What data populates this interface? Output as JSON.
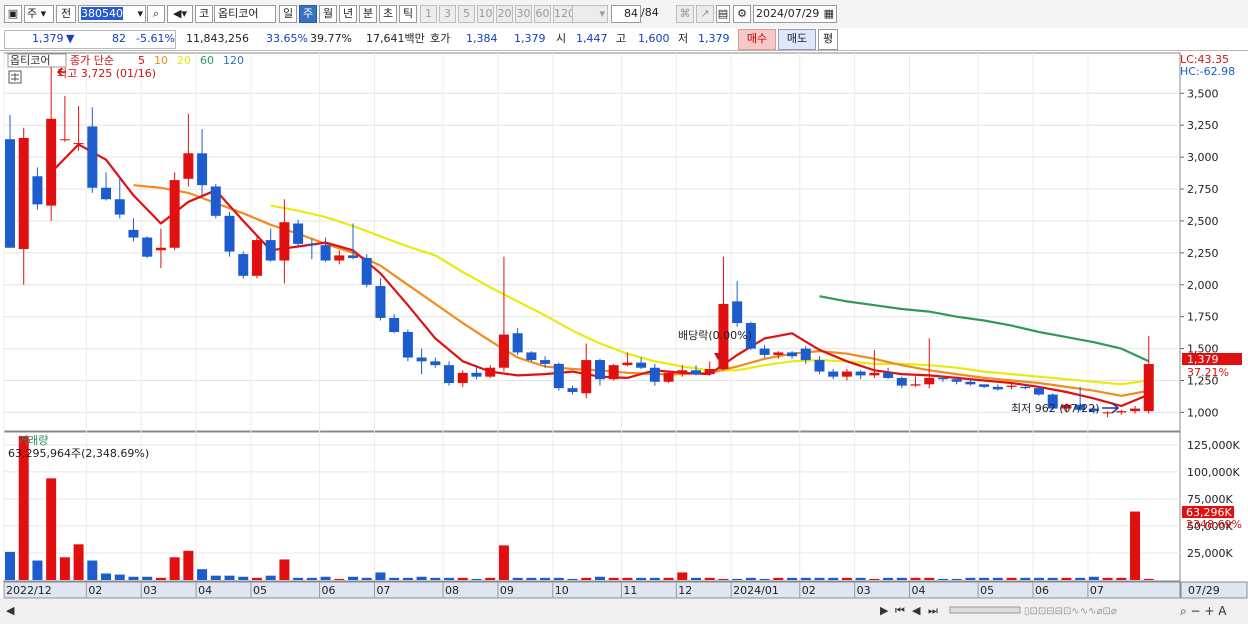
{
  "toolbar": {
    "period_type": "주",
    "view_mode": "전",
    "stock_code": "380540",
    "market_tag": "코",
    "stock_name": "옵티코어",
    "period_tabs": [
      "일",
      "주",
      "월",
      "년",
      "분",
      "초",
      "틱"
    ],
    "period_selected": "주",
    "interval_tabs": [
      "1",
      "3",
      "5",
      "10",
      "20",
      "30",
      "60",
      "120"
    ],
    "count": "84",
    "count_total": "/84",
    "date": "2024/07/29"
  },
  "quote": {
    "price": "1,379",
    "change_dir": "▼",
    "change": "82",
    "change_pct": "-5.61%",
    "volume": "11,843,256",
    "vol_ratio1": "33.65%",
    "vol_ratio2": "39.77%",
    "amount": "17,641백만",
    "ask_label": "호가",
    "ask1": "1,384",
    "ask2": "1,379",
    "open_label": "시",
    "open": "1,447",
    "high_label": "고",
    "high": "1,600",
    "low_label": "저",
    "low": "1,379",
    "buy": "매수",
    "sell": "매도",
    "avg": "평"
  },
  "price_panel": {
    "name": "옵티코어",
    "ma_label": "종가 단순",
    "ma_periods": [
      "5",
      "10",
      "20",
      "60",
      "120"
    ],
    "ma_colors": [
      "#e01010",
      "#f08c1c",
      "#eaea10",
      "#2e9a5a",
      "#2a70c0"
    ],
    "max_label": "최고 3,725 (01/16)",
    "min_label": "최저 962 (07/22)",
    "event_label": "배당락(0.00%)",
    "lc": "LC:43.35",
    "hc": "HC:-62.98",
    "current_tag": "1,379",
    "current_pct": "37.21%",
    "y_ticks": [
      "3,500",
      "3,250",
      "3,000",
      "2,750",
      "2,500",
      "2,250",
      "2,000",
      "1,750",
      "1,500",
      "1,250",
      "1,000"
    ]
  },
  "volume_panel": {
    "title": "거래량",
    "value_label": "63,295,964주(2,348.69%)",
    "current_tag": "63,296K",
    "current_pct": "2348.69%",
    "y_ticks": [
      "125,000K",
      "100,000K",
      "75,000K",
      "50,000K",
      "25,000K"
    ]
  },
  "x_axis": [
    "2022/12",
    "02",
    "03",
    "04",
    "05",
    "06",
    "07",
    "08",
    "09",
    "10",
    "11",
    "12",
    "2024/01",
    "02",
    "03",
    "04",
    "05",
    "06",
    "07"
  ],
  "x_axis_right": "07/29",
  "colors": {
    "up": "#e01010",
    "down": "#1c5ccc",
    "ma5": "#e01010",
    "ma10": "#f08c1c",
    "ma20": "#eaea10",
    "ma60": "#2e9a5a"
  },
  "chart_data": {
    "type": "candlestick",
    "period": "weekly",
    "ylim": [
      870,
      3800
    ],
    "x_labels": [
      "2022/12",
      "02",
      "03",
      "04",
      "05",
      "06",
      "07",
      "08",
      "09",
      "10",
      "11",
      "12",
      "2024/01",
      "02",
      "03",
      "04",
      "05",
      "06",
      "07"
    ],
    "candles": [
      {
        "o": 3140,
        "h": 3330,
        "l": 2290,
        "c": 2290
      },
      {
        "o": 2280,
        "h": 3230,
        "l": 2000,
        "c": 3150
      },
      {
        "o": 2850,
        "h": 2920,
        "l": 2590,
        "c": 2630
      },
      {
        "o": 2620,
        "h": 3725,
        "l": 2500,
        "c": 3300
      },
      {
        "o": 3140,
        "h": 3480,
        "l": 3120,
        "c": 3140
      },
      {
        "o": 3110,
        "h": 3400,
        "l": 3050,
        "c": 3110
      },
      {
        "o": 3240,
        "h": 3390,
        "l": 2720,
        "c": 2760
      },
      {
        "o": 2760,
        "h": 2880,
        "l": 2660,
        "c": 2670
      },
      {
        "o": 2670,
        "h": 2840,
        "l": 2520,
        "c": 2550
      },
      {
        "o": 2430,
        "h": 2520,
        "l": 2340,
        "c": 2370
      },
      {
        "o": 2370,
        "h": 2380,
        "l": 2210,
        "c": 2220
      },
      {
        "o": 2270,
        "h": 2440,
        "l": 2130,
        "c": 2290
      },
      {
        "o": 2290,
        "h": 2880,
        "l": 2270,
        "c": 2820
      },
      {
        "o": 2830,
        "h": 3340,
        "l": 2770,
        "c": 3030
      },
      {
        "o": 3030,
        "h": 3220,
        "l": 2700,
        "c": 2780
      },
      {
        "o": 2770,
        "h": 2790,
        "l": 2520,
        "c": 2540
      },
      {
        "o": 2540,
        "h": 2570,
        "l": 2220,
        "c": 2260
      },
      {
        "o": 2240,
        "h": 2260,
        "l": 2050,
        "c": 2070
      },
      {
        "o": 2070,
        "h": 2380,
        "l": 2050,
        "c": 2350
      },
      {
        "o": 2350,
        "h": 2440,
        "l": 2180,
        "c": 2190
      },
      {
        "o": 2190,
        "h": 2670,
        "l": 2010,
        "c": 2490
      },
      {
        "o": 2480,
        "h": 2510,
        "l": 2300,
        "c": 2320
      },
      {
        "o": 2320,
        "h": 2360,
        "l": 2200,
        "c": 2310
      },
      {
        "o": 2310,
        "h": 2370,
        "l": 2180,
        "c": 2190
      },
      {
        "o": 2190,
        "h": 2270,
        "l": 2160,
        "c": 2230
      },
      {
        "o": 2230,
        "h": 2480,
        "l": 2200,
        "c": 2210
      },
      {
        "o": 2210,
        "h": 2240,
        "l": 1980,
        "c": 2000
      },
      {
        "o": 1990,
        "h": 2050,
        "l": 1720,
        "c": 1740
      },
      {
        "o": 1740,
        "h": 1770,
        "l": 1620,
        "c": 1630
      },
      {
        "o": 1630,
        "h": 1650,
        "l": 1400,
        "c": 1430
      },
      {
        "o": 1430,
        "h": 1500,
        "l": 1300,
        "c": 1400
      },
      {
        "o": 1400,
        "h": 1430,
        "l": 1350,
        "c": 1370
      },
      {
        "o": 1370,
        "h": 1400,
        "l": 1210,
        "c": 1230
      },
      {
        "o": 1230,
        "h": 1330,
        "l": 1200,
        "c": 1310
      },
      {
        "o": 1310,
        "h": 1370,
        "l": 1260,
        "c": 1280
      },
      {
        "o": 1280,
        "h": 1370,
        "l": 1270,
        "c": 1350
      },
      {
        "o": 1350,
        "h": 2220,
        "l": 1320,
        "c": 1610
      },
      {
        "o": 1620,
        "h": 1660,
        "l": 1450,
        "c": 1470
      },
      {
        "o": 1470,
        "h": 1480,
        "l": 1400,
        "c": 1410
      },
      {
        "o": 1410,
        "h": 1440,
        "l": 1350,
        "c": 1380
      },
      {
        "o": 1380,
        "h": 1390,
        "l": 1170,
        "c": 1190
      },
      {
        "o": 1190,
        "h": 1210,
        "l": 1140,
        "c": 1160
      },
      {
        "o": 1150,
        "h": 1540,
        "l": 1110,
        "c": 1410
      },
      {
        "o": 1410,
        "h": 1420,
        "l": 1210,
        "c": 1260
      },
      {
        "o": 1260,
        "h": 1380,
        "l": 1250,
        "c": 1370
      },
      {
        "o": 1370,
        "h": 1470,
        "l": 1360,
        "c": 1390
      },
      {
        "o": 1390,
        "h": 1430,
        "l": 1340,
        "c": 1350
      },
      {
        "o": 1350,
        "h": 1380,
        "l": 1210,
        "c": 1240
      },
      {
        "o": 1240,
        "h": 1330,
        "l": 1230,
        "c": 1310
      },
      {
        "o": 1310,
        "h": 1370,
        "l": 1280,
        "c": 1330
      },
      {
        "o": 1330,
        "h": 1370,
        "l": 1290,
        "c": 1300
      },
      {
        "o": 1300,
        "h": 1400,
        "l": 1290,
        "c": 1340
      },
      {
        "o": 1340,
        "h": 2220,
        "l": 1330,
        "c": 1850
      },
      {
        "o": 1870,
        "h": 2030,
        "l": 1670,
        "c": 1700
      },
      {
        "o": 1700,
        "h": 1710,
        "l": 1490,
        "c": 1500
      },
      {
        "o": 1500,
        "h": 1530,
        "l": 1430,
        "c": 1450
      },
      {
        "o": 1450,
        "h": 1480,
        "l": 1420,
        "c": 1470
      },
      {
        "o": 1470,
        "h": 1480,
        "l": 1420,
        "c": 1440
      },
      {
        "o": 1500,
        "h": 1520,
        "l": 1380,
        "c": 1410
      },
      {
        "o": 1410,
        "h": 1440,
        "l": 1300,
        "c": 1320
      },
      {
        "o": 1320,
        "h": 1340,
        "l": 1260,
        "c": 1280
      },
      {
        "o": 1280,
        "h": 1340,
        "l": 1250,
        "c": 1320
      },
      {
        "o": 1320,
        "h": 1330,
        "l": 1260,
        "c": 1290
      },
      {
        "o": 1290,
        "h": 1490,
        "l": 1270,
        "c": 1310
      },
      {
        "o": 1310,
        "h": 1350,
        "l": 1260,
        "c": 1270
      },
      {
        "o": 1270,
        "h": 1280,
        "l": 1190,
        "c": 1210
      },
      {
        "o": 1210,
        "h": 1280,
        "l": 1200,
        "c": 1220
      },
      {
        "o": 1220,
        "h": 1580,
        "l": 1190,
        "c": 1270
      },
      {
        "o": 1270,
        "h": 1290,
        "l": 1240,
        "c": 1260
      },
      {
        "o": 1260,
        "h": 1270,
        "l": 1220,
        "c": 1240
      },
      {
        "o": 1240,
        "h": 1260,
        "l": 1210,
        "c": 1220
      },
      {
        "o": 1220,
        "h": 1220,
        "l": 1190,
        "c": 1200
      },
      {
        "o": 1200,
        "h": 1220,
        "l": 1170,
        "c": 1180
      },
      {
        "o": 1200,
        "h": 1230,
        "l": 1180,
        "c": 1210
      },
      {
        "o": 1200,
        "h": 1220,
        "l": 1180,
        "c": 1190
      },
      {
        "o": 1190,
        "h": 1200,
        "l": 1130,
        "c": 1140
      },
      {
        "o": 1140,
        "h": 1150,
        "l": 1020,
        "c": 1030
      },
      {
        "o": 1030,
        "h": 1070,
        "l": 1000,
        "c": 1060
      },
      {
        "o": 1060,
        "h": 1200,
        "l": 1010,
        "c": 1020
      },
      {
        "o": 1030,
        "h": 1050,
        "l": 990,
        "c": 1010
      },
      {
        "o": 1000,
        "h": 1010,
        "l": 962,
        "c": 1000
      },
      {
        "o": 1000,
        "h": 1020,
        "l": 980,
        "c": 1010
      },
      {
        "o": 1010,
        "h": 1050,
        "l": 990,
        "c": 1030
      },
      {
        "o": 1010,
        "h": 1600,
        "l": 990,
        "c": 1379
      }
    ],
    "volume_ylim": [
      0,
      135000
    ],
    "volume_k": [
      26000,
      133000,
      18000,
      94000,
      21000,
      33000,
      18000,
      6000,
      5000,
      3000,
      3000,
      2000,
      21000,
      27000,
      10000,
      4000,
      4000,
      3000,
      2000,
      4000,
      19000,
      2000,
      2000,
      3000,
      1000,
      3000,
      2000,
      7000,
      2000,
      2000,
      3000,
      2000,
      2000,
      2000,
      1000,
      2000,
      32000,
      2000,
      2000,
      2000,
      2000,
      1000,
      2000,
      3000,
      2000,
      2000,
      2000,
      2000,
      2000,
      7000,
      2000,
      2000,
      1000,
      1000,
      2000,
      1000,
      2000,
      2000,
      2000,
      2000,
      2000,
      2000,
      2000,
      1000,
      2000,
      2000,
      2000,
      2000,
      1000,
      1000,
      2000,
      2000,
      2000,
      2000,
      2000,
      2000,
      2000,
      2000,
      2000,
      3000,
      2000,
      2000,
      63296,
      1000
    ],
    "ma5": [
      [
        3,
        2880
      ],
      [
        5,
        3100
      ],
      [
        7,
        2980
      ],
      [
        9,
        2700
      ],
      [
        11,
        2480
      ],
      [
        13,
        2650
      ],
      [
        15,
        2740
      ],
      [
        17,
        2500
      ],
      [
        19,
        2270
      ],
      [
        21,
        2300
      ],
      [
        23,
        2330
      ],
      [
        25,
        2270
      ],
      [
        27,
        2090
      ],
      [
        29,
        1840
      ],
      [
        31,
        1580
      ],
      [
        33,
        1400
      ],
      [
        35,
        1320
      ],
      [
        37,
        1290
      ],
      [
        39,
        1300
      ],
      [
        41,
        1320
      ],
      [
        43,
        1280
      ],
      [
        45,
        1270
      ],
      [
        47,
        1330
      ],
      [
        49,
        1310
      ],
      [
        51,
        1300
      ],
      [
        53,
        1450
      ],
      [
        55,
        1580
      ],
      [
        57,
        1620
      ],
      [
        59,
        1490
      ],
      [
        61,
        1400
      ],
      [
        63,
        1330
      ],
      [
        65,
        1300
      ],
      [
        67,
        1290
      ],
      [
        69,
        1270
      ],
      [
        71,
        1250
      ],
      [
        73,
        1230
      ],
      [
        75,
        1200
      ],
      [
        77,
        1160
      ],
      [
        79,
        1110
      ],
      [
        81,
        1050
      ],
      [
        83,
        1140
      ]
    ],
    "ma10": [
      [
        9,
        2780
      ],
      [
        11,
        2760
      ],
      [
        13,
        2720
      ],
      [
        15,
        2640
      ],
      [
        17,
        2560
      ],
      [
        19,
        2470
      ],
      [
        21,
        2400
      ],
      [
        23,
        2320
      ],
      [
        25,
        2250
      ],
      [
        27,
        2150
      ],
      [
        29,
        2000
      ],
      [
        31,
        1850
      ],
      [
        33,
        1700
      ],
      [
        35,
        1560
      ],
      [
        37,
        1430
      ],
      [
        39,
        1360
      ],
      [
        41,
        1340
      ],
      [
        43,
        1330
      ],
      [
        45,
        1310
      ],
      [
        47,
        1300
      ],
      [
        49,
        1300
      ],
      [
        51,
        1310
      ],
      [
        53,
        1360
      ],
      [
        55,
        1420
      ],
      [
        57,
        1460
      ],
      [
        59,
        1480
      ],
      [
        61,
        1460
      ],
      [
        63,
        1420
      ],
      [
        65,
        1370
      ],
      [
        67,
        1330
      ],
      [
        69,
        1300
      ],
      [
        71,
        1270
      ],
      [
        73,
        1250
      ],
      [
        75,
        1230
      ],
      [
        77,
        1200
      ],
      [
        79,
        1170
      ],
      [
        81,
        1130
      ],
      [
        83,
        1170
      ]
    ],
    "ma20": [
      [
        19,
        2620
      ],
      [
        21,
        2580
      ],
      [
        23,
        2530
      ],
      [
        25,
        2460
      ],
      [
        27,
        2380
      ],
      [
        29,
        2300
      ],
      [
        31,
        2230
      ],
      [
        33,
        2100
      ],
      [
        35,
        1980
      ],
      [
        37,
        1870
      ],
      [
        39,
        1760
      ],
      [
        41,
        1640
      ],
      [
        43,
        1540
      ],
      [
        45,
        1460
      ],
      [
        47,
        1400
      ],
      [
        49,
        1360
      ],
      [
        51,
        1330
      ],
      [
        53,
        1330
      ],
      [
        55,
        1370
      ],
      [
        57,
        1400
      ],
      [
        59,
        1410
      ],
      [
        61,
        1400
      ],
      [
        63,
        1380
      ],
      [
        65,
        1380
      ],
      [
        67,
        1370
      ],
      [
        69,
        1350
      ],
      [
        71,
        1320
      ],
      [
        73,
        1300
      ],
      [
        75,
        1280
      ],
      [
        77,
        1260
      ],
      [
        79,
        1240
      ],
      [
        81,
        1220
      ],
      [
        83,
        1250
      ]
    ],
    "ma60": [
      [
        59,
        1910
      ],
      [
        61,
        1870
      ],
      [
        63,
        1840
      ],
      [
        65,
        1810
      ],
      [
        67,
        1790
      ],
      [
        69,
        1750
      ],
      [
        71,
        1720
      ],
      [
        73,
        1680
      ],
      [
        75,
        1630
      ],
      [
        77,
        1590
      ],
      [
        79,
        1550
      ],
      [
        81,
        1500
      ],
      [
        83,
        1400
      ]
    ]
  }
}
